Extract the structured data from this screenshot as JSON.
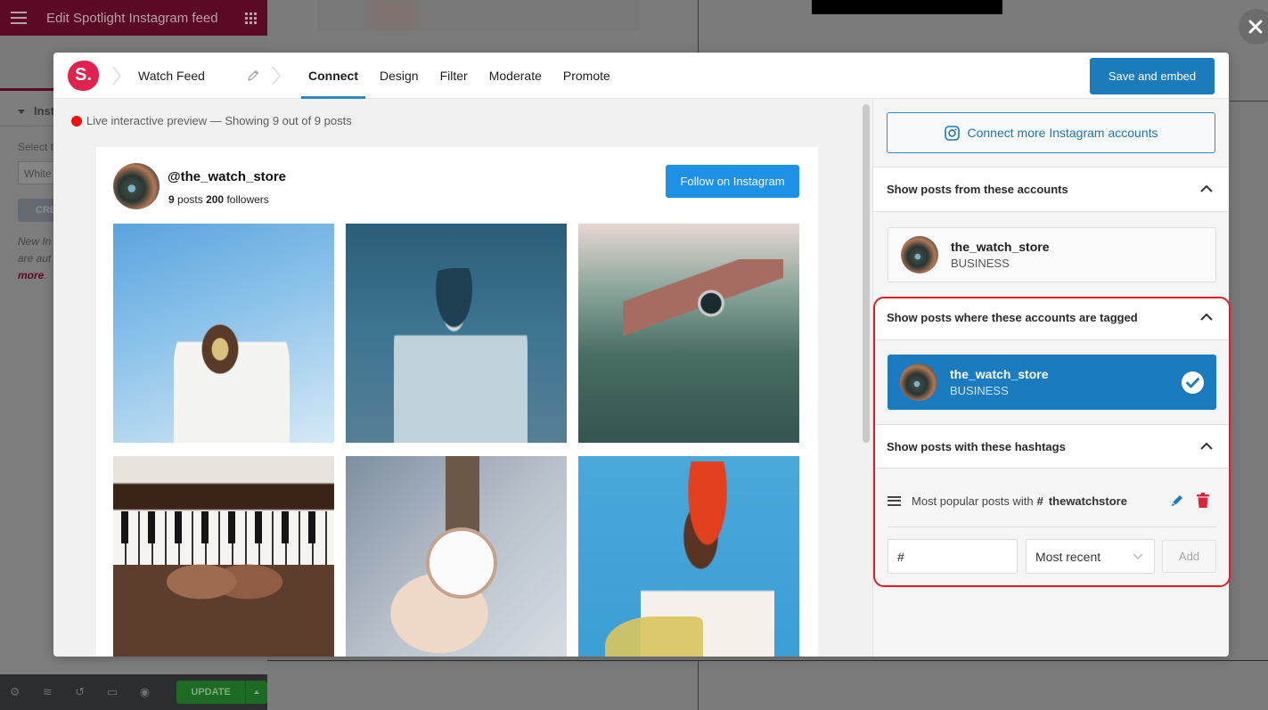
{
  "background": {
    "editor_title": "Edit Spotlight Instagram feed",
    "section_label": "Inst",
    "select_label": "Select t",
    "select_value": "White",
    "create_button": "CRE",
    "note_line1": "New In",
    "note_line2": "are aut",
    "note_link": "more",
    "note_period": ".",
    "footer": {
      "icons": [
        "gear-icon",
        "layers-icon",
        "history-icon",
        "responsive-icon",
        "eye-icon"
      ],
      "update_label": "UPDATE"
    }
  },
  "modal": {
    "logo_text": "S.",
    "feed_name": "Watch Feed",
    "tabs": [
      {
        "label": "Connect",
        "active": true
      },
      {
        "label": "Design",
        "active": false
      },
      {
        "label": "Filter",
        "active": false
      },
      {
        "label": "Moderate",
        "active": false
      },
      {
        "label": "Promote",
        "active": false
      }
    ],
    "save_label": "Save and embed"
  },
  "preview": {
    "live_text": "Live interactive preview — Showing 9 out of 9 posts",
    "username": "@the_watch_store",
    "posts_count": "9",
    "posts_label": "posts",
    "followers_count": "200",
    "followers_label": "followers",
    "follow_label": "Follow on Instagram",
    "photos": [
      "man-with-watch-sky",
      "woman-in-hat-with-watch",
      "hand-with-watch-in-water",
      "hands-on-piano-with-watch",
      "hand-holding-watch",
      "woman-in-red-headscarf-with-watch"
    ]
  },
  "settings": {
    "connect_label": "Connect more Instagram accounts",
    "sections": {
      "from_accounts": {
        "title": "Show posts from these accounts",
        "account": {
          "name": "the_watch_store",
          "type": "BUSINESS",
          "selected": false
        }
      },
      "tagged": {
        "title": "Show posts where these accounts are tagged",
        "account": {
          "name": "the_watch_store",
          "type": "BUSINESS",
          "selected": true
        }
      },
      "hashtags": {
        "title": "Show posts with these hashtags",
        "item": {
          "prefix": "Most popular posts with",
          "symbol": "#",
          "tag": "thewatchstore"
        },
        "input_value": "#",
        "order_value": "Most recent",
        "add_label": "Add"
      }
    }
  },
  "colors": {
    "accent_blue": "#1c7bbb",
    "follow_blue": "#1e90e6",
    "logo_red": "#e0234e",
    "live_dot": "#ee1111",
    "highlight_red": "#e41b23",
    "delete_red": "#d9263a",
    "elementor_maroon": "#5a0a24",
    "update_green": "#1d6a24"
  }
}
